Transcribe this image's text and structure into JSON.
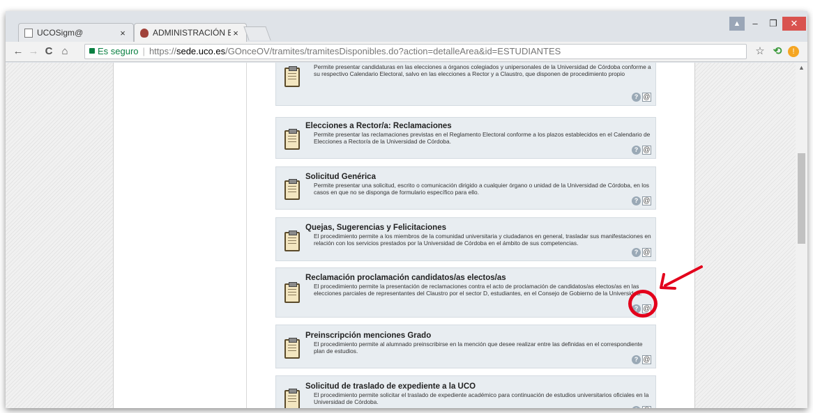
{
  "browser": {
    "tabs": [
      {
        "title": "UCOSigm@",
        "close": "×"
      },
      {
        "title": "ADMINISTRACIÓN ELECT",
        "close": "×"
      }
    ],
    "window": {
      "user": "▲",
      "min": "–",
      "max": "❐",
      "close": "✕"
    },
    "nav": {
      "back": "←",
      "forward": "→",
      "reload": "C",
      "home": "⌂"
    },
    "address": {
      "secure_label": "Es seguro",
      "scheme": "https://",
      "host": "sede.uco.es",
      "path": "/GOnceOV/tramites/tramitesDisponibles.do?action=detalleArea&id=ESTUDIANTES"
    },
    "toolbar_right": {
      "star": "☆",
      "ext": "⟲",
      "warn": "!"
    }
  },
  "cards": [
    {
      "title": "",
      "description": "Permite presentar candidaturas en las elecciones a órganos colegiados y unipersonales de la Universidad de Córdoba conforme a su respectivo Calendario Electoral, salvo en las elecciones a Rector y a Claustro, que disponen de procedimiento propio"
    },
    {
      "title": "Elecciones a Rector/a: Reclamaciones",
      "description": "Permite presentar las reclamaciones previstas en el Reglamento Electoral conforme a los plazos establecidos en el Calendario de Elecciones a Rector/a de la Universidad de Córdoba."
    },
    {
      "title": "Solicitud Genérica",
      "description": "Permite presentar una solicitud, escrito o comunicación dirigido a cualquier órgano o unidad de la Universidad de Córdoba, en los casos en que no se disponga de formulario específico para ello."
    },
    {
      "title": "Quejas, Sugerencias y Felicitaciones",
      "description": "El procedimiento permite a los miembros de la comunidad universitaria y ciudadanos en general, trasladar sus manifestaciones en relación con los servicios prestados por la Universidad de Córdoba en el ámbito de sus competencias."
    },
    {
      "title": "Reclamación proclamación candidatos/as electos/as",
      "description": "El procedimiento permite la presentación de reclamaciones contra el acto de proclamación de candidatos/as electos/as en las elecciones parciales de representantes del Claustro por el sector D, estudiantes, en el Consejo de Gobierno de la Universidad."
    },
    {
      "title": "Preinscripción menciones Grado",
      "description": "El procedimiento permite al alumnado preinscribirse en la mención que desee realizar entre las definidas en el correspondiente plan de estudios."
    },
    {
      "title": "Solicitud de traslado de expediente a la UCO",
      "description": "El procedimiento permite solicitar el traslado de expediente académico para continuación de estudios universitarios oficiales en la Universidad de Córdoba."
    }
  ],
  "actions": {
    "help": "?",
    "online": "@"
  },
  "colors": {
    "card_bg": "#e8edf1",
    "callout": "#e3001b",
    "secure": "#0b8043"
  }
}
